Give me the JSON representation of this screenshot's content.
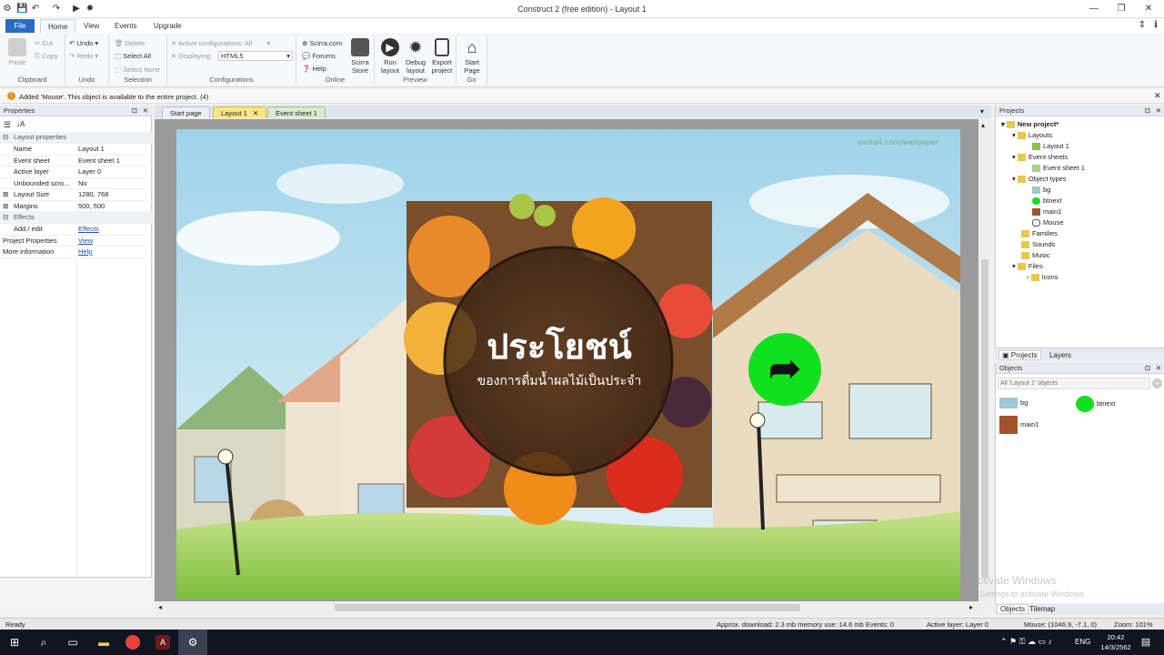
{
  "window": {
    "title": "Construct 2  (free edition) - Layout 1"
  },
  "ribbon_tabs": [
    "File",
    "Home",
    "View",
    "Events",
    "Upgrade"
  ],
  "clipboard": {
    "paste": "Paste",
    "cut": "Cut",
    "copy": "Copy",
    "label": "Clipboard"
  },
  "undo": {
    "undo": "Undo",
    "redo": "Redo",
    "label": "Undo"
  },
  "selection": {
    "delete": "Delete",
    "select_all": "Select All",
    "select_none": "Select None",
    "label": "Selection"
  },
  "configurations": {
    "active": "Active configurations: All",
    "displaying_label": "Displaying:",
    "displaying_value": "HTML5",
    "label": "Configurations"
  },
  "online": {
    "scirra": "Scirra.com",
    "forums": "Forums",
    "help": "Help",
    "store_line1": "Scirra",
    "store_line2": "Store",
    "label": "Online"
  },
  "preview": {
    "run1": "Run",
    "run2": "layout",
    "debug1": "Debug",
    "debug2": "layout",
    "export1": "Export",
    "export2": "project",
    "label": "Preview"
  },
  "go": {
    "start1": "Start",
    "start2": "Page",
    "label": "Go"
  },
  "message": "Added 'Mouse'. This object is available to the entire project.  (4)",
  "properties": {
    "header": "Properties",
    "section_layout": "Layout properties",
    "rows": [
      {
        "k": "Name",
        "v": "Layout 1"
      },
      {
        "k": "Event sheet",
        "v": "Event sheet 1"
      },
      {
        "k": "Active layer",
        "v": "Layer 0"
      },
      {
        "k": "Unbounded scro...",
        "v": "No"
      },
      {
        "k": "Layout Size",
        "v": "1280, 768"
      },
      {
        "k": "Margins",
        "v": "500, 500"
      }
    ],
    "section_effects": "Effects",
    "add_edit": "Add / edit",
    "effects_link": "Effects",
    "project_props": "Project Properties",
    "view_link": "View",
    "more_info": "More information",
    "help_link": "Help"
  },
  "doc_tabs": [
    "Start page",
    "Layout 1",
    "Event sheet 1"
  ],
  "layout_art": {
    "watermark": "yenta4.com/wallpaper",
    "headline": "ประโยชน์",
    "subline": "ของการดื่มน้ำผลไม้เป็นประจำ"
  },
  "projects": {
    "header": "Projects",
    "root": "New project*",
    "items": [
      "Layouts",
      "Layout 1",
      "Event sheets",
      "Event sheet 1",
      "Object types",
      "bg",
      "btnext",
      "main1",
      "Mouse",
      "Families",
      "Sounds",
      "Music",
      "Files",
      "Icons"
    ],
    "tab_projects": "Projects",
    "tab_layers": "Layers"
  },
  "objects": {
    "header": "Objects",
    "filter_placeholder": "All 'Layout 1' objects",
    "items": [
      "bg",
      "btnext",
      "main1"
    ],
    "tab_objects": "Objects",
    "tab_tilemap": "Tilemap"
  },
  "watermark_win": {
    "line1": "ctivate Windows",
    "line2": "Settings to activate Windows."
  },
  "status": {
    "left": "Ready",
    "download": "Approx. download: 2.3 mb  memory use: 14.6 mb  Events: 0",
    "layer": "Active layer: Layer 0",
    "mouse": "Mouse: (1046.9, -7.1, 0)",
    "zoom": "Zoom: 101%"
  },
  "taskbar": {
    "lang": "ENG",
    "time": "20:42",
    "date": "14/3/2562"
  }
}
